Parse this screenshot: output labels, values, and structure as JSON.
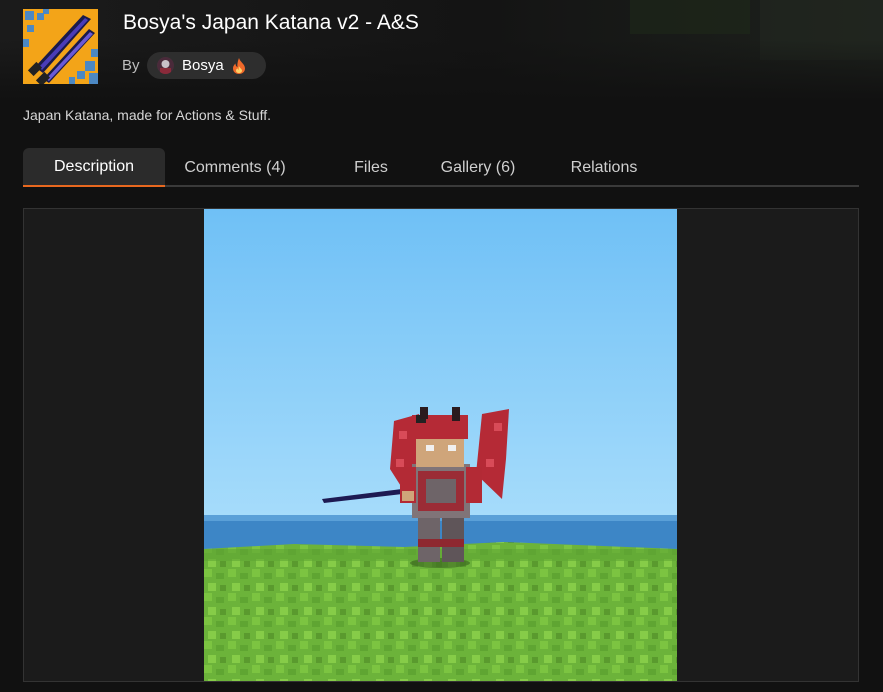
{
  "project": {
    "title": "Bosya's Japan Katana v2 - A&S",
    "by_label": "By",
    "author": "Bosya",
    "summary": "Japan Katana, made for Actions & Stuff.",
    "icon": "katana-logo-icon",
    "author_badge_icon": "flame-icon"
  },
  "tabs": [
    {
      "label": "Description",
      "active": true
    },
    {
      "label": "Comments (4)",
      "active": false
    },
    {
      "label": "Files",
      "active": false
    },
    {
      "label": "Gallery (6)",
      "active": false
    },
    {
      "label": "Relations",
      "active": false
    }
  ],
  "colors": {
    "background": "#111111",
    "accent": "#e8681f",
    "tab_active_bg": "#2b2b2b",
    "chip_bg": "#2e2e2e"
  }
}
